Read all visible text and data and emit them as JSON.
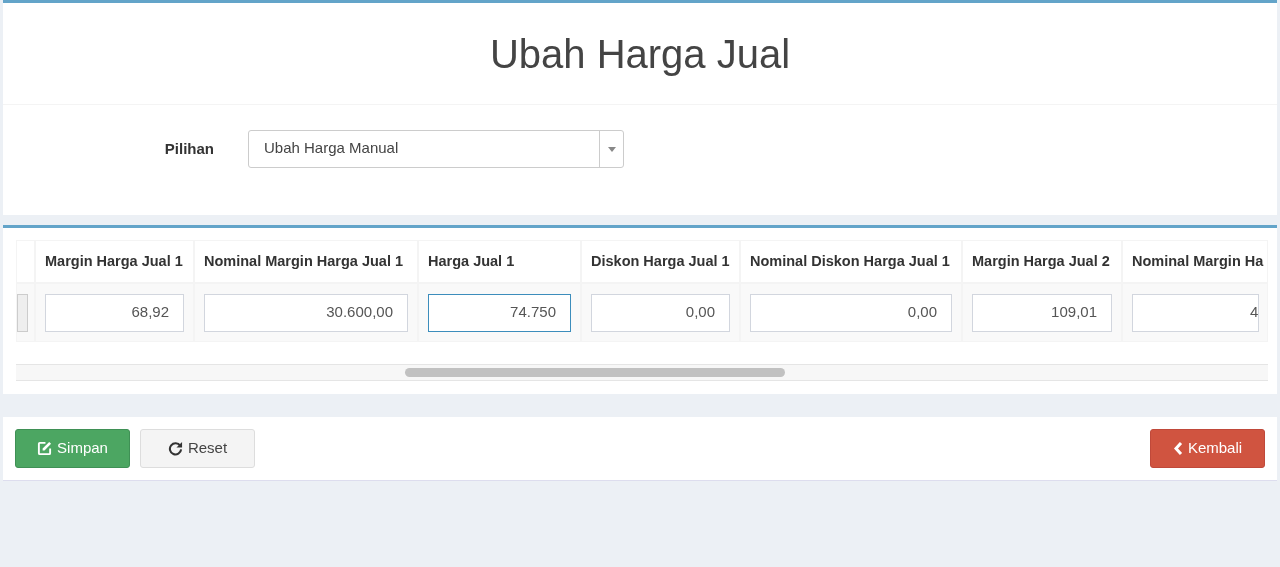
{
  "title": "Ubah Harga Jual",
  "form": {
    "label": "Pilihan",
    "select_value": "Ubah Harga Manual"
  },
  "table": {
    "columns": [
      "Margin Harga Jual 1",
      "Nominal Margin Harga Jual 1",
      "Harga Jual 1",
      "Diskon Harga Jual 1",
      "Nominal Diskon Harga Jual 1",
      "Margin Harga Jual 2",
      "Nominal Margin Ha"
    ],
    "rows": [
      {
        "cells": [
          {
            "value": "68,92",
            "focused": false
          },
          {
            "value": "30.600,00",
            "focused": false
          },
          {
            "value": "74.750",
            "focused": true
          },
          {
            "value": "0,00",
            "focused": false
          },
          {
            "value": "0,00",
            "focused": false
          },
          {
            "value": "109,01",
            "focused": false
          },
          {
            "value": "4",
            "focused": false
          }
        ]
      }
    ]
  },
  "buttons": [
    {
      "kind": "save",
      "label": "Simpan"
    },
    {
      "kind": "reset",
      "label": "Reset"
    },
    {
      "kind": "back",
      "label": "Kembali"
    }
  ]
}
